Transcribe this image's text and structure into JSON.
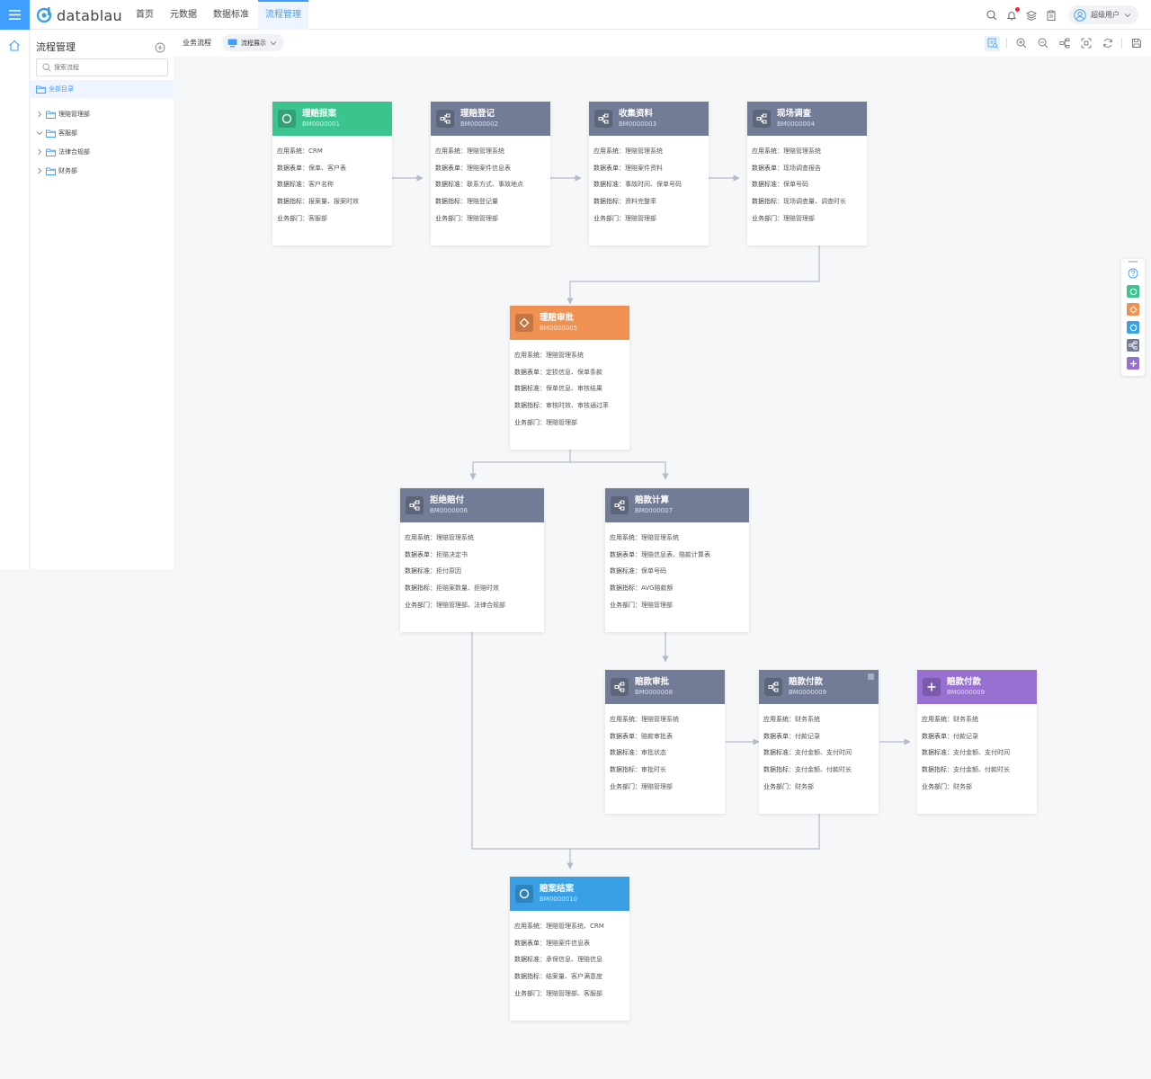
{
  "app": {
    "logo_text": "datablau",
    "brand_color": "#409eff"
  },
  "nav": [
    {
      "label": "首页"
    },
    {
      "label": "元数据"
    },
    {
      "label": "数据标准"
    },
    {
      "label": "流程管理",
      "active": true
    }
  ],
  "user": {
    "name": "超级用户"
  },
  "sidebar": {
    "title": "流程管理",
    "search_placeholder": "搜索流程",
    "all_label": "全部目录",
    "tree": [
      {
        "label": "理赔管理部",
        "expanded": false
      },
      {
        "label": "客服部",
        "expanded": true
      },
      {
        "label": "法律合规部",
        "expanded": false
      },
      {
        "label": "财务部",
        "expanded": false
      }
    ]
  },
  "toolbar": {
    "label": "业务流程",
    "view_select": "流程展示"
  },
  "field_labels": {
    "system": "应用系统：",
    "table": "数据表单：",
    "standard": "数据标准：",
    "metric": "数据指标：",
    "dept": "业务部门："
  },
  "nodes": [
    {
      "name": "理赔报案",
      "code": "BM0000001",
      "type": "start",
      "color": "#3cc48f",
      "system": "CRM",
      "table": "保单、客户表",
      "standard": "客户名称",
      "metric": "报案量、报案时效",
      "dept": "客服部"
    },
    {
      "name": "理赔登记",
      "code": "BM0000002",
      "type": "task",
      "color": "#727c96",
      "system": "理赔管理系统",
      "table": "理赔案件信息表",
      "standard": "联系方式、事故地点",
      "metric": "理赔登记量",
      "dept": "理赔管理部"
    },
    {
      "name": "收集资料",
      "code": "BM0000003",
      "type": "task",
      "color": "#727c96",
      "system": "理赔管理系统",
      "table": "理赔案件资料",
      "standard": "事故时间、保单号码",
      "metric": "资料完整率",
      "dept": "理赔管理部"
    },
    {
      "name": "现场调查",
      "code": "BM0000004",
      "type": "task",
      "color": "#727c96",
      "system": "理赔管理系统",
      "table": "现场调查报告",
      "standard": "保单号码",
      "metric": "现场调查量、调查时长",
      "dept": "理赔管理部"
    },
    {
      "name": "理赔审批",
      "code": "BM0000005",
      "type": "gateway",
      "color": "#f09151",
      "system": "理赔管理系统",
      "table": "定损信息、保单条款",
      "standard": "保单信息、审核结果",
      "metric": "审核时效、审核通过率",
      "dept": "理赔管理部"
    },
    {
      "name": "拒绝赔付",
      "code": "BM0000006",
      "type": "task",
      "color": "#727c96",
      "system": "理赔管理系统",
      "table": "拒赔决定书",
      "standard": "拒付原因",
      "metric": "拒赔案数量、拒赔时效",
      "dept": "理赔管理部、法律合规部"
    },
    {
      "name": "赔款计算",
      "code": "BM0000007",
      "type": "task",
      "color": "#727c96",
      "system": "理赔管理系统",
      "table": "理赔信息表、赔款计算表",
      "standard": "保单号码",
      "metric": "AVG赔款额",
      "dept": "理赔管理部"
    },
    {
      "name": "赔款审批",
      "code": "BM0000008",
      "type": "task",
      "color": "#727c96",
      "system": "理赔管理系统",
      "table": "赔款审批表",
      "standard": "审批状态",
      "metric": "审批时长",
      "dept": "理赔管理部"
    },
    {
      "name": "赔款付款",
      "code": "BM0000009",
      "type": "task",
      "color": "#727c96",
      "system": "财务系统",
      "table": "付款记录",
      "standard": "支付金额、支付时间",
      "metric": "支付金额、付款时长",
      "dept": "财务部"
    },
    {
      "name": "赔款付款",
      "code": "BM0000009",
      "type": "sub",
      "color": "#9770d1",
      "system": "财务系统",
      "table": "付款记录",
      "standard": "支付金额、支付时间",
      "metric": "支付金额、付款时长",
      "dept": "财务部"
    },
    {
      "name": "赔案结案",
      "code": "BM0000010",
      "type": "end",
      "color": "#3aa0e6",
      "system": "理赔管理系统、CRM",
      "table": "理赔案件信息表",
      "standard": "承保信息、理赔信息",
      "metric": "结案量、客户满意度",
      "dept": "理赔管理部、客服部"
    }
  ],
  "palette": [
    {
      "icon": "help-icon"
    },
    {
      "icon": "start-node-icon",
      "color": "#3cc48f"
    },
    {
      "icon": "gateway-node-icon",
      "color": "#f09151"
    },
    {
      "icon": "end-node-icon",
      "color": "#3aa0e6"
    },
    {
      "icon": "task-node-icon",
      "color": "#727c96"
    },
    {
      "icon": "subprocess-node-icon",
      "color": "#9770d1"
    }
  ]
}
